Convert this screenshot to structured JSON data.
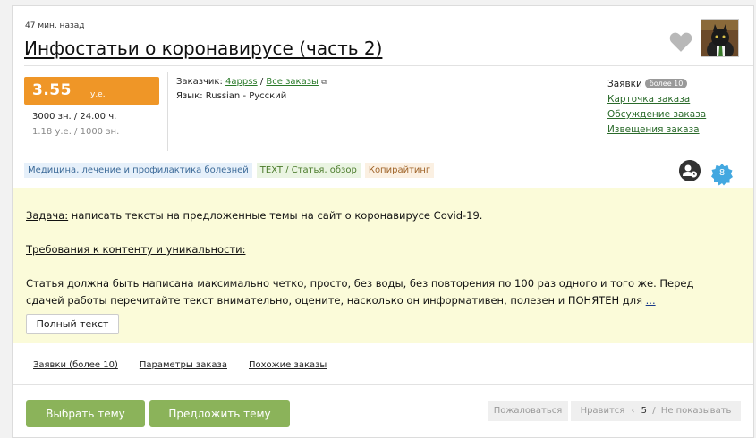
{
  "header": {
    "time_ago": "47 мин. назад",
    "title": "Инфостатьи о коронавирусе (часть 2)"
  },
  "price": {
    "value": "3.55",
    "currency": "у.е.",
    "stats": "3000 зн. / 24.00 ч.",
    "rate": "1.18 у.е. / 1000 зн.",
    "accent_color": "#ef9627"
  },
  "meta": {
    "customer_label": "Заказчик:",
    "customer_name": "4appss",
    "separator": "/",
    "all_orders": "Все заказы",
    "language_label": "Язык:",
    "language_value": "Russian - Русский"
  },
  "right_links": {
    "applications": "Заявки",
    "applications_badge": "более 10",
    "order_card": "Карточка заказа",
    "discussion": "Обсуждение заказа",
    "notifications": "Извещения заказа"
  },
  "tags": [
    {
      "label": "Медицина, лечение и профилактика болезней",
      "color": "#3c6a98"
    },
    {
      "label": "TEXT / Статья, обзор",
      "color": "#4a7a2a"
    },
    {
      "label": "Копирайтинг",
      "color": "#a0652a"
    }
  ],
  "count_badge": "8",
  "task": {
    "task_label": "Задача:",
    "task_text": " написать тексты на предложенные темы на сайт о коронавирусе Covid-19.",
    "req_label": "Требования к контенту и уникальности:",
    "body_line1": "Статья должна быть написана максимально четко, просто, без воды, без повторения по 100 раз одного и того же. Перед",
    "body_line2": "сдачей работы перечитайте текст внимательно, оцените, насколько он информативен, полезен и ПОНЯТЕН для ",
    "more": "...",
    "full_text_button": "Полный текст"
  },
  "subnav": {
    "applications": "Заявки (более 10)",
    "parameters": "Параметры заказа",
    "similar": "Похожие заказы"
  },
  "actions": {
    "choose_topic": "Выбрать тему",
    "propose_topic": "Предложить тему",
    "complain": "Пожаловаться",
    "like": "Нравится",
    "like_count": "5",
    "hide": "Не показывать",
    "button_color": "#8bb35a"
  }
}
